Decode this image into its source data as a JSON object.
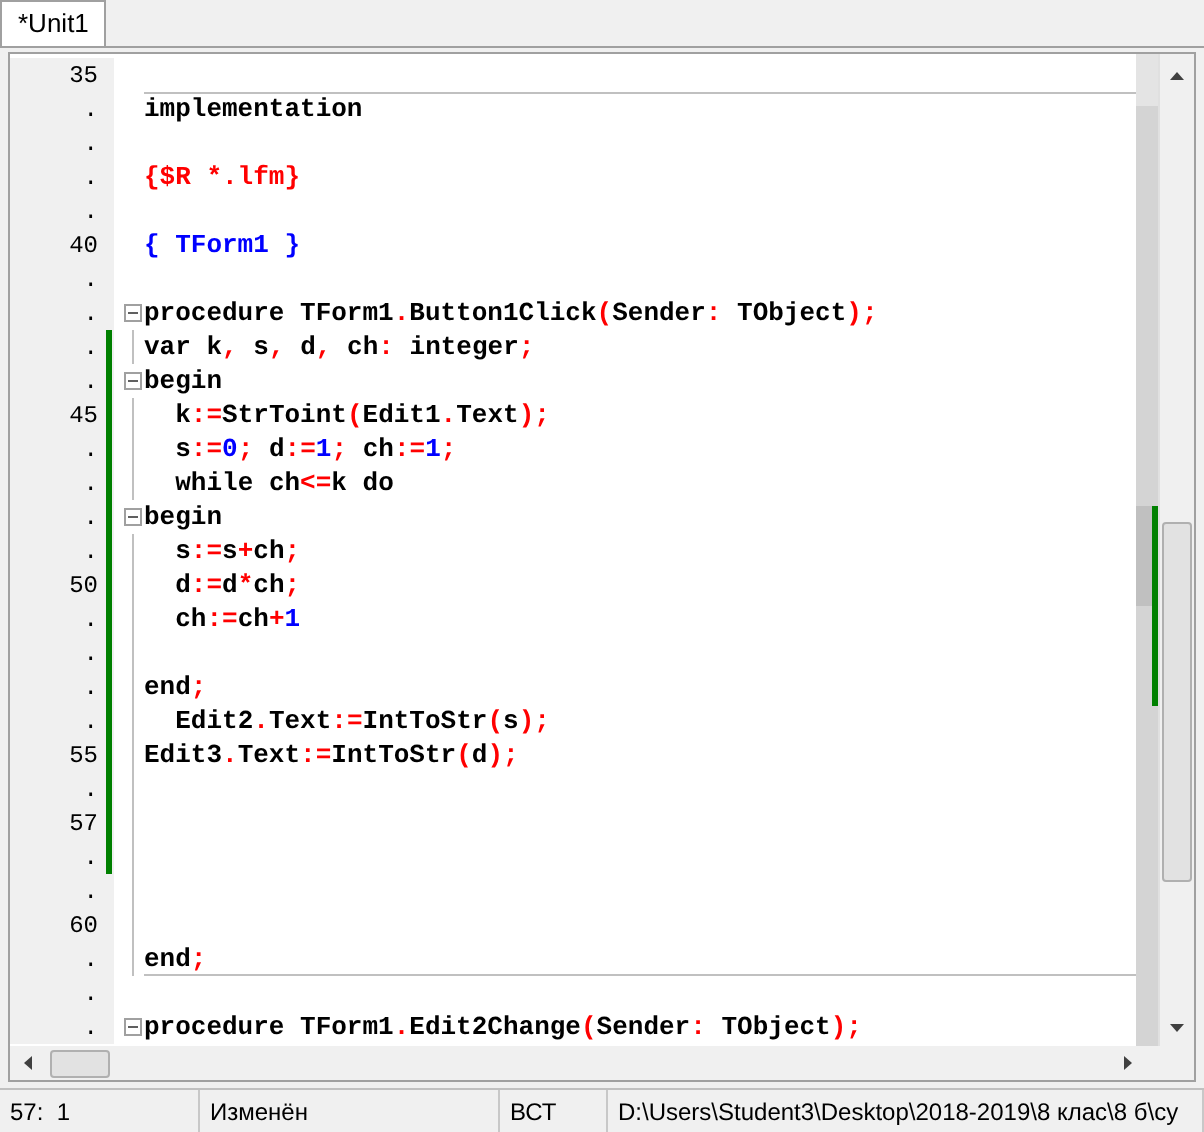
{
  "tabs": [
    {
      "label": "*Unit1",
      "selected": true
    }
  ],
  "editor": {
    "rows": [
      {
        "gutter": "35"
      },
      {
        "gutter": ".",
        "kind": "code",
        "text": "implementation",
        "divider_above": true
      },
      {
        "gutter": "."
      },
      {
        "gutter": ".",
        "kind": "directive",
        "text": "{$R *.lfm}"
      },
      {
        "gutter": "."
      },
      {
        "gutter": "40",
        "kind": "comment",
        "text": "{ TForm1 }"
      },
      {
        "gutter": "."
      },
      {
        "gutter": ".",
        "kind": "code",
        "text": "procedure TForm1.Button1Click(Sender: TObject);",
        "fold_start": true
      },
      {
        "gutter": ".",
        "kind": "code",
        "text": "var k, s, d, ch: integer;",
        "fold_line": true,
        "modified": true
      },
      {
        "gutter": ".",
        "kind": "code",
        "text": "begin",
        "fold_start": true,
        "modified": true
      },
      {
        "gutter": "45",
        "kind": "code",
        "text": "  k:=StrToint(Edit1.Text);",
        "fold_line": true,
        "modified": true
      },
      {
        "gutter": ".",
        "kind": "code",
        "text": "  s:=0; d:=1; ch:=1;",
        "fold_line": true,
        "modified": true
      },
      {
        "gutter": ".",
        "kind": "code",
        "text": "  while ch<=k do",
        "fold_line": true,
        "modified": true
      },
      {
        "gutter": ".",
        "kind": "code",
        "text": "begin",
        "fold_start": true,
        "modified": true
      },
      {
        "gutter": ".",
        "kind": "code",
        "text": "  s:=s+ch;",
        "fold_line": true,
        "modified": true
      },
      {
        "gutter": "50",
        "kind": "code",
        "text": "  d:=d*ch;",
        "fold_line": true,
        "modified": true
      },
      {
        "gutter": ".",
        "kind": "code",
        "text": "  ch:=ch+1",
        "fold_line": true,
        "modified": true
      },
      {
        "gutter": ".",
        "fold_line": true,
        "modified": true
      },
      {
        "gutter": ".",
        "kind": "code",
        "text": "end;",
        "fold_line": true,
        "modified": true
      },
      {
        "gutter": ".",
        "kind": "code",
        "text": "  Edit2.Text:=IntToStr(s);",
        "fold_line": true,
        "modified": true
      },
      {
        "gutter": "55",
        "kind": "code",
        "text": "Edit3.Text:=IntToStr(d);",
        "fold_line": true,
        "modified": true
      },
      {
        "gutter": ".",
        "fold_line": true,
        "modified": true
      },
      {
        "gutter": "57",
        "fold_line": true,
        "modified": true
      },
      {
        "gutter": ".",
        "fold_line": true,
        "modified": true
      },
      {
        "gutter": ".",
        "fold_line": true
      },
      {
        "gutter": "60",
        "fold_line": true
      },
      {
        "gutter": ".",
        "kind": "code",
        "text": "end;",
        "fold_line": true,
        "divider_below": true
      },
      {
        "gutter": "."
      },
      {
        "gutter": ".",
        "kind": "code",
        "text": "procedure TForm1.Edit2Change(Sender: TObject);",
        "fold_start": true
      }
    ]
  },
  "status_bar": [
    {
      "text": "57:  1"
    },
    {
      "text": "Изменён"
    },
    {
      "text": "ВСТ"
    },
    {
      "text": "D:\\Users\\Student3\\Desktop\\2018-2019\\8 клас\\8 б\\су"
    }
  ]
}
